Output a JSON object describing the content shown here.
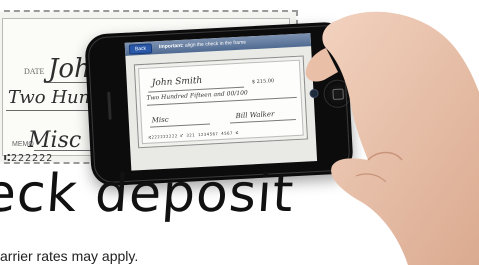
{
  "background_check": {
    "date_label": "DATE",
    "payee_script": "John",
    "amount_words_script": "Two Hund",
    "memo_label": "MEMO",
    "memo_script": "Misc",
    "micr_line": "⑆222222"
  },
  "phone": {
    "status_bar": {
      "back_label": "Back",
      "message_bold": "Important:",
      "message_rest": " align the check in the frame"
    },
    "check": {
      "payee_script": "John Smith",
      "amount_words_script": "Two Hundred Fifteen and 00/100",
      "amount_box": "$ 215.00",
      "memo_script": "Misc",
      "signature_script": "Bill Walker",
      "micr_line": "⑆222222222 ⑈ 321 1234567 4567 ⑆"
    }
  },
  "headline": "eck deposit",
  "subtext": "arrier rates may apply."
}
